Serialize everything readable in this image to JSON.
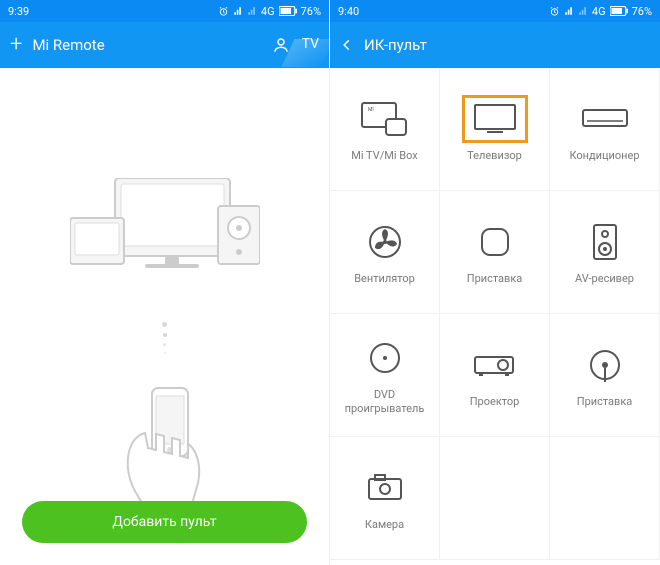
{
  "status": {
    "time_left": "9:39",
    "time_right": "9:40",
    "network": "4G",
    "battery": "76%"
  },
  "left": {
    "title": "Mi Remote",
    "tv_tab": "TV",
    "add_button": "Добавить пульт"
  },
  "right": {
    "title": "ИК-пульт",
    "devices": [
      {
        "label": "Mi TV/Mi Box",
        "icon": "mitv",
        "selected": false
      },
      {
        "label": "Телевизор",
        "icon": "tv",
        "selected": true
      },
      {
        "label": "Кондиционер",
        "icon": "ac",
        "selected": false
      },
      {
        "label": "Вентилятор",
        "icon": "fan",
        "selected": false
      },
      {
        "label": "Приставка",
        "icon": "settop",
        "selected": false
      },
      {
        "label": "AV-ресивер",
        "icon": "av",
        "selected": false
      },
      {
        "label": "DVD проигрыватель",
        "icon": "dvd",
        "selected": false
      },
      {
        "label": "Проектор",
        "icon": "projector",
        "selected": false
      },
      {
        "label": "Приставка",
        "icon": "cable",
        "selected": false
      },
      {
        "label": "Камера",
        "icon": "camera",
        "selected": false
      }
    ]
  },
  "colors": {
    "accent": "#1296f3",
    "green": "#4cc11f",
    "highlight": "#ee9a1f"
  }
}
